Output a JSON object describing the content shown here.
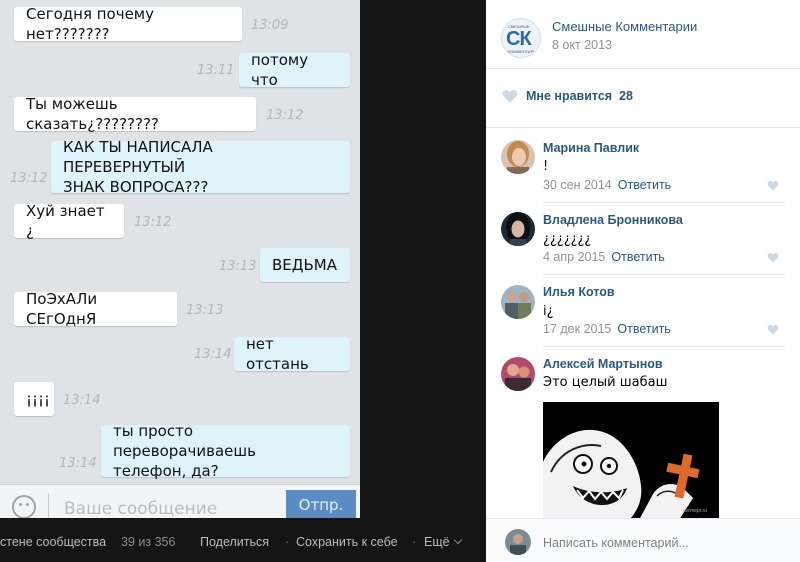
{
  "chat": {
    "messages": [
      {
        "text": "Сегодня почему нет???????",
        "time": "13:09"
      },
      {
        "text": "потому что",
        "time": "13:11"
      },
      {
        "text": "Ты можешь сказать¿????????",
        "time": "13:12"
      },
      {
        "text_line1": "КАК ТЫ НАПИСАЛА ПЕРЕВЕРНУТЫЙ",
        "text_line2": "ЗНАК ВОПРОСА???",
        "time": "13:12"
      },
      {
        "text": "Хуй знает ¿",
        "time": "13:12"
      },
      {
        "text": "ВЕДЬМА",
        "time": "13:13"
      },
      {
        "text": "ПоЭхАЛи СЕгОднЯ",
        "time": "13:13"
      },
      {
        "text": "нет отстань",
        "time": "13:14"
      },
      {
        "text": "¡¡¡¡",
        "time": "13:14"
      },
      {
        "text_line1": "ты просто переворачиваешь",
        "text_line2": "телефон, да?",
        "time": "13:14"
      }
    ],
    "composer_placeholder": "Ваше сообщение",
    "send_label": "Отпр."
  },
  "toolbar": {
    "wall_label": "стене сообщества",
    "counter": "39 из 356",
    "share": "Поделиться",
    "dot1": "·",
    "save": "Сохранить к себе",
    "dot2": "·",
    "more": "Ещё"
  },
  "post": {
    "group_logo_text": "СК",
    "group_logo_top": "СМЕШНЫЕ",
    "group_logo_bottom": "КОММЕНТАРИИ",
    "group_name": "Смешные Комментарии",
    "date": "8 окт 2013",
    "like_label": "Мне нравится",
    "like_count": "28"
  },
  "comments": [
    {
      "author": "Марина Павлик",
      "text": "!",
      "date": "30 сен 2014",
      "reply": "Ответить"
    },
    {
      "author": "Владлена Бронникова",
      "text": "¿¿¿¿¿¿¿",
      "date": "4 апр 2015",
      "reply": "Ответить"
    },
    {
      "author": "Илья Котов",
      "text": "i¿",
      "date": "17 дек 2015",
      "reply": "Ответить"
    },
    {
      "author": "Алексей Мартынов",
      "text": "Это целый шабаш"
    }
  ],
  "meme_watermark": "memepr.ru",
  "footer": {
    "placeholder": "Написать комментарий..."
  },
  "colors": {
    "link": "#2a5885",
    "send_button": "#5b8cc4",
    "outgoing_bubble": "#dff3fb"
  }
}
